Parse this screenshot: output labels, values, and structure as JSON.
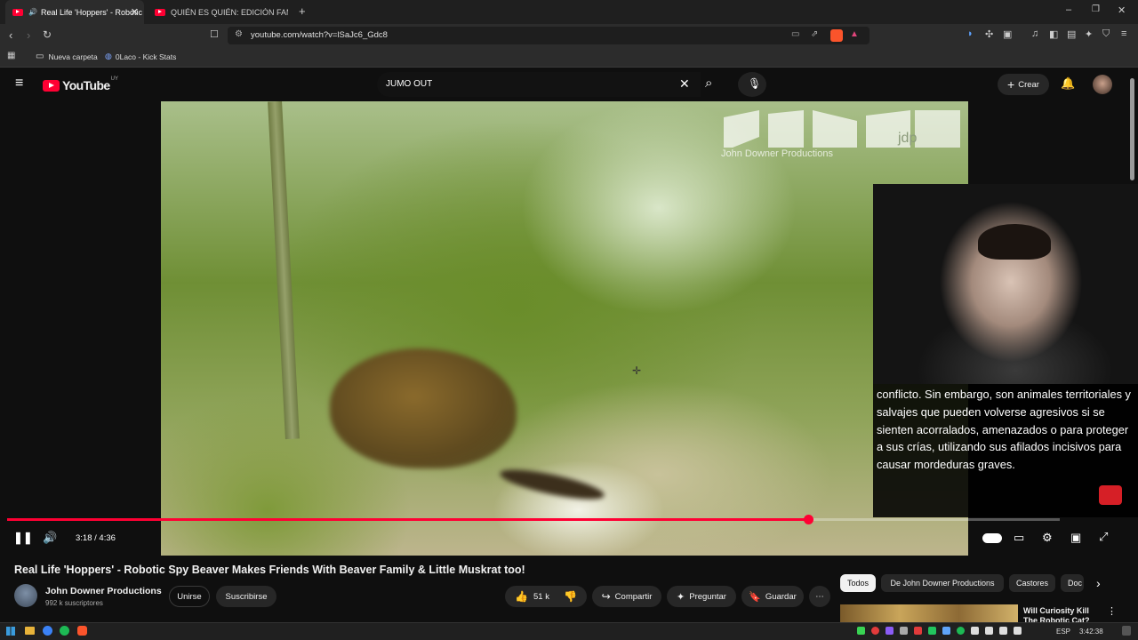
{
  "browser": {
    "tabs": [
      {
        "label": "Real Life 'Hoppers' - Robotic",
        "active": true
      },
      {
        "label": "QUIÉN ES QUIÉN: EDICIÓN FAMOSO",
        "active": false
      }
    ],
    "url": "youtube.com/watch?v=lSaJc6_Gdc8",
    "bookmarks": [
      "Nueva carpeta",
      "0Laco - Kick Stats"
    ]
  },
  "youtube": {
    "logo": "YouTube",
    "region": "UY",
    "search_value": "JUMO OUT",
    "create_label": "Crear"
  },
  "video": {
    "watermark": "John Downer Productions",
    "watermark_logo_text": "jdp",
    "subtitle": "conflicto. Sin embargo, son animales territoriales y salvajes que pueden volverse agresivos si se sienten acorralados, amenazados o para proteger a sus crías, utilizando sus afilados incisivos para causar mordeduras graves.",
    "current_time": "3:18",
    "duration": "4:36",
    "progress_fraction": 0.761,
    "buffered_fraction": 1.0,
    "time_display": "3:18 / 4:36"
  },
  "details": {
    "title": "Real Life 'Hoppers' - Robotic Spy Beaver Makes Friends With Beaver Family & Little Muskrat too!",
    "channel": "John Downer Productions",
    "subscribers": "992 k suscriptores",
    "join_label": "Unirse",
    "subscribe_label": "Suscribirse",
    "likes": "51 k",
    "share_label": "Compartir",
    "ask_label": "Preguntar",
    "save_label": "Guardar"
  },
  "chips": [
    "Todos",
    "De John Downer Productions",
    "Castores",
    "Doc"
  ],
  "recommendation": {
    "title": "Will Curiosity Kill The Robotic Cat?"
  },
  "taskbar": {
    "lang": "ESP",
    "clock": "3:42:38"
  },
  "colors": {
    "accent": "#ff0033",
    "background": "#0f0f0f",
    "chip": "#272727"
  }
}
